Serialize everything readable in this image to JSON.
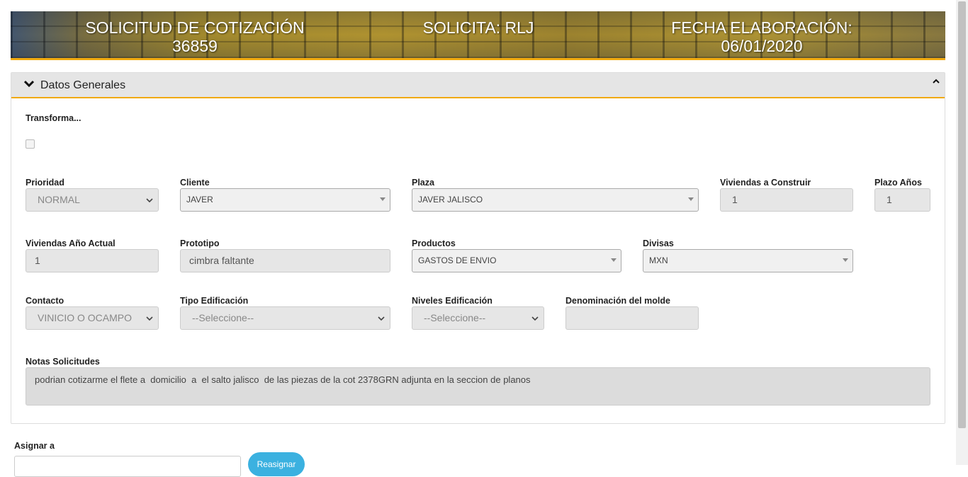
{
  "banner": {
    "solicitud_line1": "SOLICITUD DE COTIZACIÓN",
    "solicitud_line2": "36859",
    "solicita": "SOLICITA: RLJ",
    "fecha_line1": "FECHA ELABORACIÓN:",
    "fecha_line2": "06/01/2020"
  },
  "panel": {
    "title": "Datos Generales",
    "transforma_label": "Transforma...",
    "prioridad": {
      "label": "Prioridad",
      "value": "NORMAL"
    },
    "cliente": {
      "label": "Cliente",
      "value": "JAVER"
    },
    "plaza": {
      "label": "Plaza",
      "value": "JAVER JALISCO"
    },
    "viviendas_construir": {
      "label": "Viviendas a Construir",
      "value": "1"
    },
    "plazo_anos": {
      "label": "Plazo Años",
      "value": "1"
    },
    "viviendas_ano_actual": {
      "label": "Viviendas Año Actual",
      "value": "1"
    },
    "prototipo": {
      "label": "Prototipo",
      "value": "cimbra faltante"
    },
    "productos": {
      "label": "Productos",
      "value": "GASTOS DE ENVIO"
    },
    "divisas": {
      "label": "Divisas",
      "value": "MXN"
    },
    "contacto": {
      "label": "Contacto",
      "value": "VINICIO O OCAMPO"
    },
    "tipo_edificacion": {
      "label": "Tipo Edificación",
      "value": "--Seleccione--"
    },
    "niveles_edificacion": {
      "label": "Niveles Edificación",
      "value": "--Seleccione--"
    },
    "denominacion_molde": {
      "label": "Denominación del molde",
      "value": ""
    },
    "notas": {
      "label": "Notas Solicitudes",
      "value": "podrian cotizarme el flete a  domicilio  a  el salto jalisco  de las piezas de la cot 2378GRN adjunta en la seccion de planos"
    }
  },
  "assign": {
    "label": "Asignar a",
    "button": "Reasignar"
  },
  "colors": {
    "accent": "#f0a90e",
    "button": "#3bb1e0"
  }
}
